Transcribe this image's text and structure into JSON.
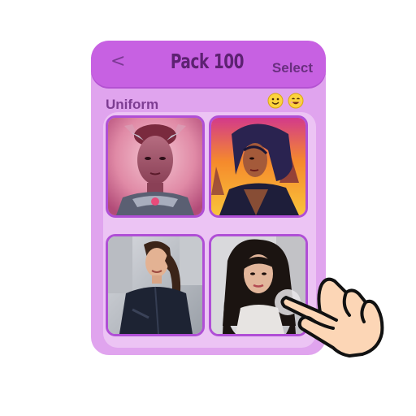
{
  "header": {
    "back_label": "<",
    "title": "Pack 100",
    "select_label": "Select"
  },
  "section": {
    "label": "Uniform",
    "icons": [
      "smile-emoji-icon",
      "grin-emoji-icon"
    ]
  },
  "grid": {
    "images": [
      "portrait-silver-armor-woman",
      "portrait-sunset-hooded-woman",
      "photo-woman-black-jacket",
      "photo-woman-dark-wavy-hair"
    ]
  },
  "overlay": {
    "icon": "tap-hand-icon"
  },
  "colors": {
    "header": "#c761e2",
    "card": "#e0a4ee",
    "panel": "#ecc4f4",
    "tile_border": "#b04fd6"
  }
}
